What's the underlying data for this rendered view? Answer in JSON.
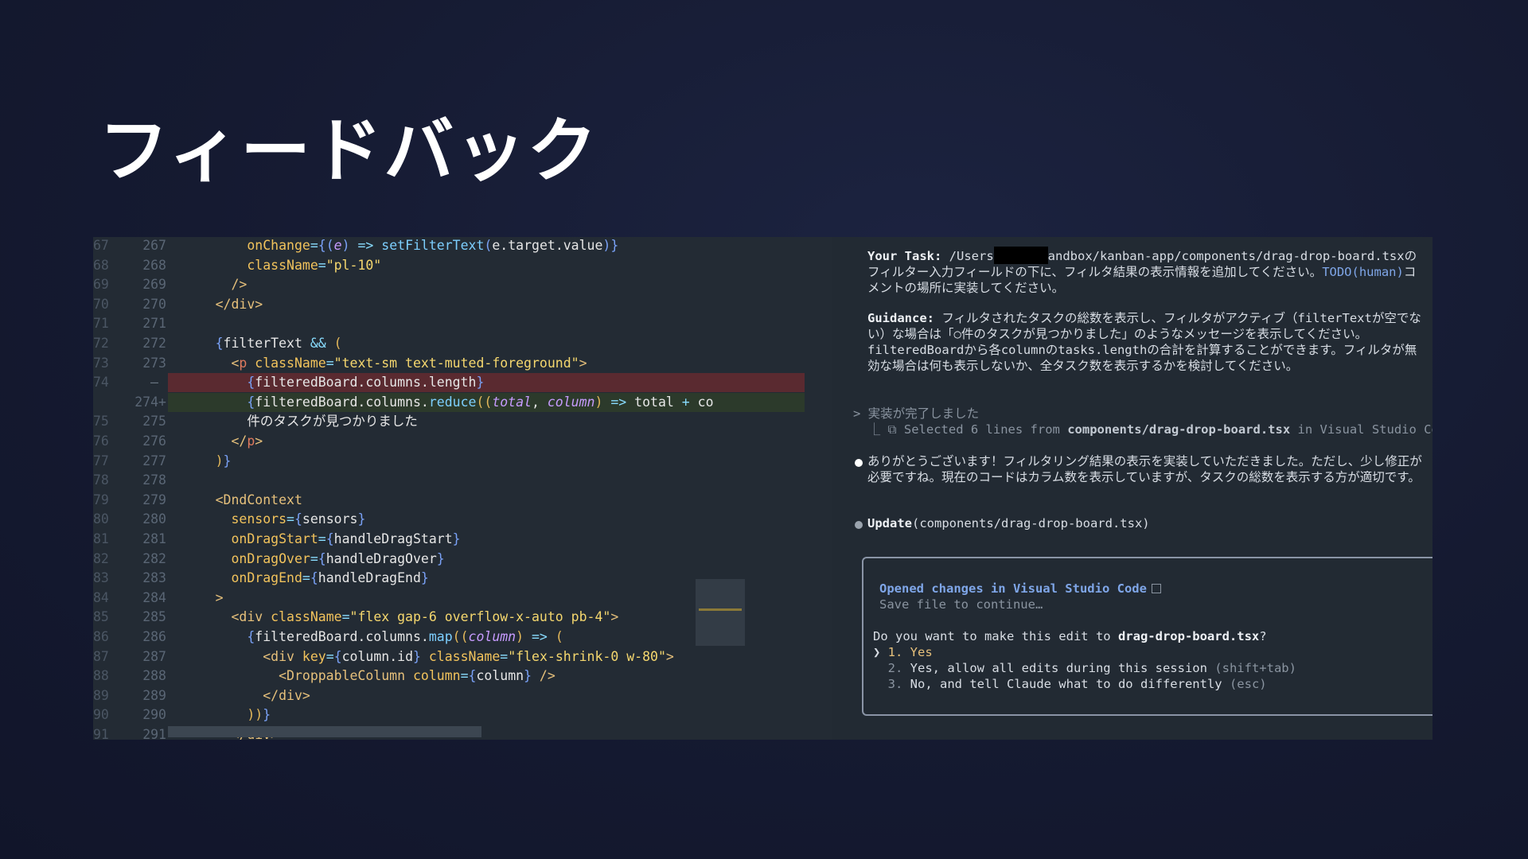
{
  "slide": {
    "title": "フィードバック"
  },
  "editor": {
    "lines": [
      {
        "old": "67",
        "new": "267",
        "mark": "",
        "type": "ctx",
        "indent": "          ",
        "tokens": [
          [
            "attr",
            "onChange"
          ],
          [
            "op",
            "="
          ],
          [
            "brace",
            "{("
          ],
          [
            "par",
            "e"
          ],
          [
            "brace",
            ")"
          ],
          [
            "op",
            " => "
          ],
          [
            "fn",
            "setFilterText"
          ],
          [
            "brace",
            "("
          ],
          [
            "var",
            "e.target.value"
          ],
          [
            "brace",
            ")}"
          ]
        ]
      },
      {
        "old": "68",
        "new": "268",
        "mark": "",
        "type": "ctx",
        "indent": "          ",
        "tokens": [
          [
            "attr",
            "className"
          ],
          [
            "op",
            "="
          ],
          [
            "str",
            "\"pl-10\""
          ]
        ]
      },
      {
        "old": "69",
        "new": "269",
        "mark": "",
        "type": "ctx",
        "indent": "        ",
        "tokens": [
          [
            "tag",
            "/>"
          ]
        ]
      },
      {
        "old": "70",
        "new": "270",
        "mark": "",
        "type": "ctx",
        "indent": "      ",
        "tokens": [
          [
            "tag",
            "</div>"
          ]
        ]
      },
      {
        "old": "71",
        "new": "271",
        "mark": "",
        "type": "ctx",
        "indent": "",
        "tokens": []
      },
      {
        "old": "72",
        "new": "272",
        "mark": "",
        "type": "ctx",
        "indent": "      ",
        "tokens": [
          [
            "brace",
            "{"
          ],
          [
            "var",
            "filterText"
          ],
          [
            "op",
            " && "
          ],
          [
            "kw",
            "("
          ]
        ]
      },
      {
        "old": "73",
        "new": "273",
        "mark": "",
        "type": "ctx",
        "indent": "        ",
        "tokens": [
          [
            "tag",
            "<"
          ],
          [
            "ptag",
            "p"
          ],
          [
            "attr",
            " className"
          ],
          [
            "op",
            "="
          ],
          [
            "str",
            "\"text-sm text-muted-foreground\""
          ],
          [
            "tag",
            ">"
          ]
        ]
      },
      {
        "old": "74",
        "new": "",
        "mark": "—",
        "type": "del",
        "indent": "          ",
        "tokens": [
          [
            "brace",
            "{"
          ],
          [
            "var",
            "filteredBoard.columns.length"
          ],
          [
            "brace",
            "}"
          ]
        ]
      },
      {
        "old": "",
        "new": "274+",
        "mark": "",
        "type": "add",
        "indent": "          ",
        "tokens": [
          [
            "brace",
            "{"
          ],
          [
            "var",
            "filteredBoard.columns."
          ],
          [
            "fn",
            "reduce"
          ],
          [
            "kw",
            "(("
          ],
          [
            "par",
            "total"
          ],
          [
            "var",
            ", "
          ],
          [
            "par",
            "column"
          ],
          [
            "kw",
            ")"
          ],
          [
            "op",
            " => "
          ],
          [
            "var",
            "total "
          ],
          [
            "op",
            "+"
          ],
          [
            "var",
            " co"
          ]
        ]
      },
      {
        "old": "75",
        "new": "275",
        "mark": "",
        "type": "ctx",
        "indent": "          ",
        "tokens": [
          [
            "var",
            "件のタスクが見つかりました"
          ]
        ]
      },
      {
        "old": "76",
        "new": "276",
        "mark": "",
        "type": "ctx",
        "indent": "        ",
        "tokens": [
          [
            "tag",
            "</"
          ],
          [
            "ptag",
            "p"
          ],
          [
            "tag",
            ">"
          ]
        ]
      },
      {
        "old": "77",
        "new": "277",
        "mark": "",
        "type": "ctx",
        "indent": "      ",
        "tokens": [
          [
            "kw",
            ")"
          ],
          [
            "brace",
            "}"
          ]
        ]
      },
      {
        "old": "78",
        "new": "278",
        "mark": "",
        "type": "ctx",
        "indent": "",
        "tokens": []
      },
      {
        "old": "79",
        "new": "279",
        "mark": "",
        "type": "ctx",
        "indent": "      ",
        "tokens": [
          [
            "tag",
            "<DndContext"
          ]
        ]
      },
      {
        "old": "80",
        "new": "280",
        "mark": "",
        "type": "ctx",
        "indent": "        ",
        "tokens": [
          [
            "attr",
            "sensors"
          ],
          [
            "op",
            "="
          ],
          [
            "brace",
            "{"
          ],
          [
            "var",
            "sensors"
          ],
          [
            "brace",
            "}"
          ]
        ]
      },
      {
        "old": "81",
        "new": "281",
        "mark": "",
        "type": "ctx",
        "indent": "        ",
        "tokens": [
          [
            "attr",
            "onDragStart"
          ],
          [
            "op",
            "="
          ],
          [
            "brace",
            "{"
          ],
          [
            "var",
            "handleDragStart"
          ],
          [
            "brace",
            "}"
          ]
        ]
      },
      {
        "old": "82",
        "new": "282",
        "mark": "",
        "type": "ctx",
        "indent": "        ",
        "tokens": [
          [
            "attr",
            "onDragOver"
          ],
          [
            "op",
            "="
          ],
          [
            "brace",
            "{"
          ],
          [
            "var",
            "handleDragOver"
          ],
          [
            "brace",
            "}"
          ]
        ]
      },
      {
        "old": "83",
        "new": "283",
        "mark": "",
        "type": "ctx",
        "indent": "        ",
        "tokens": [
          [
            "attr",
            "onDragEnd"
          ],
          [
            "op",
            "="
          ],
          [
            "brace",
            "{"
          ],
          [
            "var",
            "handleDragEnd"
          ],
          [
            "brace",
            "}"
          ]
        ]
      },
      {
        "old": "84",
        "new": "284",
        "mark": "",
        "type": "ctx",
        "indent": "      ",
        "tokens": [
          [
            "tag",
            ">"
          ]
        ]
      },
      {
        "old": "85",
        "new": "285",
        "mark": "",
        "type": "ctx",
        "indent": "        ",
        "tokens": [
          [
            "tag",
            "<div"
          ],
          [
            "attr",
            " className"
          ],
          [
            "op",
            "="
          ],
          [
            "str",
            "\"flex gap-6 overflow-x-auto pb-4\""
          ],
          [
            "tag",
            ">"
          ]
        ]
      },
      {
        "old": "86",
        "new": "286",
        "mark": "",
        "type": "ctx",
        "indent": "          ",
        "tokens": [
          [
            "brace",
            "{"
          ],
          [
            "var",
            "filteredBoard.columns."
          ],
          [
            "fn",
            "map"
          ],
          [
            "kw",
            "(("
          ],
          [
            "par",
            "column"
          ],
          [
            "kw",
            ")"
          ],
          [
            "op",
            " => "
          ],
          [
            "kw",
            "("
          ]
        ]
      },
      {
        "old": "87",
        "new": "287",
        "mark": "",
        "type": "ctx",
        "indent": "            ",
        "tokens": [
          [
            "tag",
            "<div"
          ],
          [
            "attr",
            " key"
          ],
          [
            "op",
            "="
          ],
          [
            "brace",
            "{"
          ],
          [
            "var",
            "column.id"
          ],
          [
            "brace",
            "}"
          ],
          [
            "attr",
            " className"
          ],
          [
            "op",
            "="
          ],
          [
            "str",
            "\"flex-shrink-0 w-80\""
          ],
          [
            "tag",
            ">"
          ]
        ]
      },
      {
        "old": "88",
        "new": "288",
        "mark": "",
        "type": "ctx",
        "indent": "              ",
        "tokens": [
          [
            "tag",
            "<DroppableColumn"
          ],
          [
            "attr",
            " column"
          ],
          [
            "op",
            "="
          ],
          [
            "brace",
            "{"
          ],
          [
            "var",
            "column"
          ],
          [
            "brace",
            "}"
          ],
          [
            "tag",
            " />"
          ]
        ]
      },
      {
        "old": "89",
        "new": "289",
        "mark": "",
        "type": "ctx",
        "indent": "            ",
        "tokens": [
          [
            "tag",
            "</div>"
          ]
        ]
      },
      {
        "old": "90",
        "new": "290",
        "mark": "",
        "type": "ctx",
        "indent": "          ",
        "tokens": [
          [
            "kw",
            "))"
          ],
          [
            "brace",
            "}"
          ]
        ]
      },
      {
        "old": "91",
        "new": "291",
        "mark": "",
        "type": "ctx",
        "indent": "        ",
        "tokens": [
          [
            "tag",
            "</div>"
          ]
        ]
      }
    ]
  },
  "terminal": {
    "task_label": "Your Task:",
    "task_path_start": " /Users",
    "task_path_end": "andbox/kanban-app/components/drag-drop-board.tsx",
    "task_text": "のフィルター入力フィールドの下に、フィルタ結果の表示情報を追加してください。",
    "task_todo": "TODO(human)",
    "task_text2": "コメントの場所に実装してください。",
    "guidance_label": "Guidance:",
    "guidance_text": " フィルタされたタスクの総数を表示し、フィルタがアクティブ（filterTextが空でない）な場合は「○件のタスクが見つかりました」のようなメッセージを表示してください。filteredBoardから各columnのtasks.lengthの合計を計算することができます。フィルタが無効な場合は何も表示しないか、全タスク数を表示するかを検討してください。",
    "done_prompt": "> 実装が完了しました",
    "selected_prefix": "  ⎿ ⧉ Selected 6 lines from ",
    "selected_file": "components/drag-drop-board.tsx",
    "selected_suffix": " in Visual Studio Code",
    "reply": "ありがとうございます！フィルタリング結果の表示を実装していただきました。ただし、少し修正が必要ですね。現在のコードはカラム数を表示していますが、タスクの総数を表示する方が適切です。",
    "update_label": "Update",
    "update_args": "(components/drag-drop-board.tsx)",
    "dialog": {
      "opened": "Opened changes in Visual Studio Code",
      "save_hint": "Save file to continue…",
      "question_prefix": "Do you want to make this edit to ",
      "question_file": "drag-drop-board.tsx",
      "question_suffix": "?",
      "options": [
        {
          "pointer": "❯ ",
          "num": "1.",
          "label": " Yes",
          "hint": ""
        },
        {
          "pointer": "  ",
          "num": "2.",
          "label": " Yes, allow all edits during this session",
          "hint": " (shift+tab)"
        },
        {
          "pointer": "  ",
          "num": "3.",
          "label": " No, and tell Claude what to do differently",
          "hint": " (esc)"
        }
      ]
    }
  },
  "colors": {
    "bullet_white": "#ffffff",
    "bullet_gray": "#9aa3ad",
    "option_selected": "#e6c07b"
  }
}
